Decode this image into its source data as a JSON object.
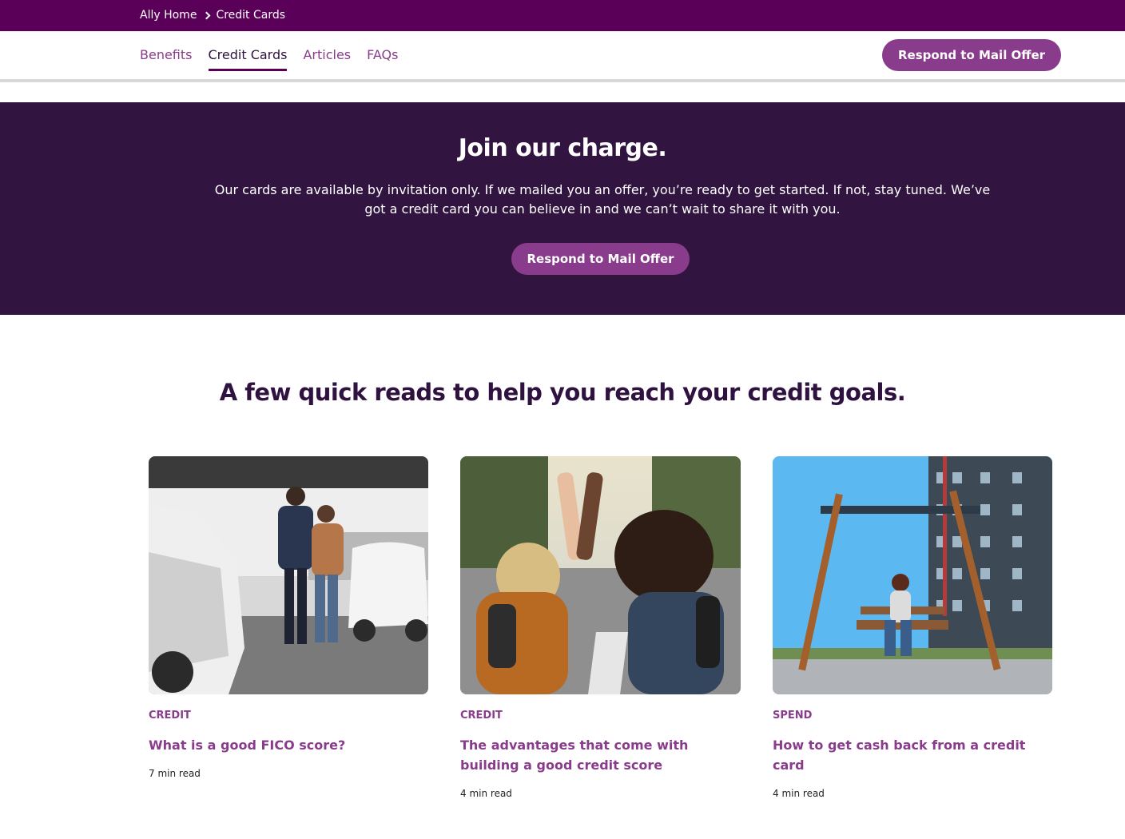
{
  "breadcrumb": {
    "home": "Ally Home",
    "current": "Credit Cards"
  },
  "nav": {
    "tabs": [
      {
        "label": "Benefits"
      },
      {
        "label": "Credit Cards"
      },
      {
        "label": "Articles"
      },
      {
        "label": "FAQs"
      }
    ],
    "active_tab": "Credit Cards",
    "cta": "Respond to Mail Offer"
  },
  "hero": {
    "title": "Join our charge.",
    "body": "Our cards are available by invitation only. If we mailed you an offer, you’re ready to get started. If not, stay tuned. We’ve got a credit card you can believe in and we can’t wait to share it with you.",
    "cta": "Respond to Mail Offer"
  },
  "reads": {
    "title": "A few quick reads to help you reach your credit goals.",
    "cards": [
      {
        "category": "CREDIT",
        "title": "What is a good FICO score?",
        "read_time": "7 min read"
      },
      {
        "category": "CREDIT",
        "title": "The advantages that come with building a good credit score",
        "read_time": "4 min read"
      },
      {
        "category": "SPEND",
        "title": "How to get cash back from a credit card",
        "read_time": "4 min read"
      }
    ]
  },
  "colors": {
    "brand": "#5b0059",
    "accent": "#8a3c8c",
    "hero_bg": "#311540",
    "heading": "#2f1240"
  }
}
